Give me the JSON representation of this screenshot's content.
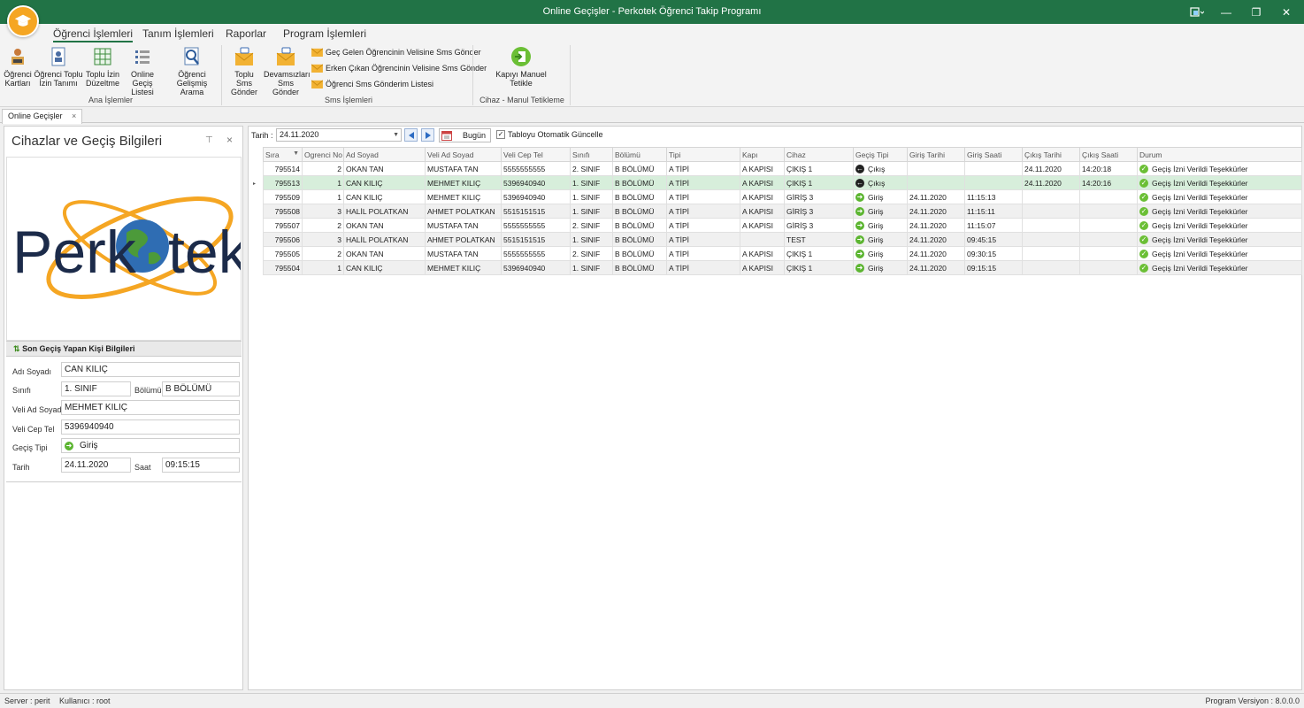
{
  "window": {
    "title": "Online Geçişler - Perkotek Öğrenci Takip Programı",
    "controls": {
      "restore": "❐",
      "minimize": "—",
      "maximize": "☐",
      "close": "✕"
    }
  },
  "menu": {
    "tabs": [
      "Öğrenci İşlemleri",
      "Tanım İşlemleri",
      "Raporlar",
      "Program İşlemleri"
    ]
  },
  "ribbon": {
    "ana": {
      "group_label": "Ana İşlemler",
      "buttons": [
        {
          "line1": "Öğrenci",
          "line2": "Kartları",
          "icon": "person-card-icon"
        },
        {
          "line1": "Öğrenci Toplu",
          "line2": "İzin Tanımı",
          "icon": "document-person-icon"
        },
        {
          "line1": "Toplu İzin",
          "line2": "Düzeltme",
          "icon": "grid-icon"
        },
        {
          "line1": "Online Geçiş",
          "line2": "Listesi",
          "icon": "list-icon"
        },
        {
          "line1": "Öğrenci",
          "line2": "Gelişmiş Arama",
          "icon": "magnifier-icon"
        }
      ]
    },
    "sms": {
      "group_label": "Sms İşlemleri",
      "buttons": [
        {
          "line1": "Toplu Sms",
          "line2": "Gönder",
          "icon": "sms-envelope-icon"
        },
        {
          "line1": "Devamsızları",
          "line2": "Sms Gönder",
          "icon": "sms-envelope-icon"
        }
      ],
      "items": [
        "Geç Gelen Öğrencinin Velisine Sms Gönder",
        "Erken Çıkan Öğrencinin Velisine Sms Gönder",
        "Öğrenci Sms Gönderim Listesi"
      ]
    },
    "cihaz": {
      "group_label": "Cihaz - Manul Tetikleme",
      "button": {
        "line1": "Kapıyı Manuel",
        "line2": "Tetikle",
        "icon": "door-trigger-icon"
      }
    }
  },
  "doc_tab": {
    "label": "Online Geçişler",
    "close": "×"
  },
  "left_panel": {
    "title": "Cihazlar ve Geçiş Bilgileri",
    "pin": "⊤",
    "close": "×",
    "logo_text": "Perkotek",
    "section_title": "Son Geçiş Yapan Kişi Bilgileri",
    "fields": {
      "adi_soyadi": {
        "label": "Adı Soyadı",
        "value": "CAN KILIÇ"
      },
      "sinifi": {
        "label": "Sınıfı",
        "value": "1. SINIF"
      },
      "bolumu": {
        "label": "Bölümü",
        "value": "B BÖLÜMÜ"
      },
      "veli_ad_soyad": {
        "label": "Veli Ad Soyad",
        "value": "MEHMET KILIÇ"
      },
      "veli_cep_tel": {
        "label": "Veli Cep Tel",
        "value": "5396940940"
      },
      "gecis_tipi": {
        "label": "Geçiş Tipi",
        "value": "Giriş"
      },
      "tarih": {
        "label": "Tarih",
        "value": "24.11.2020"
      },
      "saat": {
        "label": "Saat",
        "value": "09:15:15"
      }
    }
  },
  "toolbar": {
    "tarih_label": "Tarih :",
    "tarih_value": "24.11.2020",
    "bugun_label": "Bugün",
    "auto_update_label": "Tabloyu Otomatik Güncelle",
    "auto_update_checked": true
  },
  "grid": {
    "columns": [
      "Sıra",
      "Ogrenci No",
      "Ad Soyad",
      "Veli Ad Soyad",
      "Veli Cep Tel",
      "Sınıfı",
      "Bölümü",
      "Tipi",
      "Kapı",
      "Cihaz",
      "Geçiş Tipi",
      "Giriş Tarihi",
      "Giriş Saati",
      "Çıkış Tarihi",
      "Çıkış Saati",
      "Durum"
    ],
    "selected_row": 1,
    "rows": [
      [
        "795514",
        "2",
        "OKAN TAN",
        "MUSTAFA TAN",
        "5555555555",
        "2. SINIF",
        "B BÖLÜMÜ",
        "A TİPİ",
        "A KAPISI",
        "ÇIKIŞ 1",
        "Çıkış",
        "",
        "",
        "24.11.2020",
        "14:20:18",
        "Geçiş İzni Verildi Teşekkürler"
      ],
      [
        "795513",
        "1",
        "CAN KILIÇ",
        "MEHMET KILIÇ",
        "5396940940",
        "1. SINIF",
        "B BÖLÜMÜ",
        "A TİPİ",
        "A KAPISI",
        "ÇIKIŞ 1",
        "Çıkış",
        "",
        "",
        "24.11.2020",
        "14:20:16",
        "Geçiş İzni Verildi Teşekkürler"
      ],
      [
        "795509",
        "1",
        "CAN KILIÇ",
        "MEHMET KILIÇ",
        "5396940940",
        "1. SINIF",
        "B BÖLÜMÜ",
        "A TİPİ",
        "A KAPISI",
        "GİRİŞ 3",
        "Giriş",
        "24.11.2020",
        "11:15:13",
        "",
        "",
        "Geçiş İzni Verildi Teşekkürler"
      ],
      [
        "795508",
        "3",
        "HALİL POLATKAN",
        "AHMET POLATKAN",
        "5515151515",
        "1. SINIF",
        "B BÖLÜMÜ",
        "A TİPİ",
        "A KAPISI",
        "GİRİŞ 3",
        "Giriş",
        "24.11.2020",
        "11:15:11",
        "",
        "",
        "Geçiş İzni Verildi Teşekkürler"
      ],
      [
        "795507",
        "2",
        "OKAN TAN",
        "MUSTAFA TAN",
        "5555555555",
        "2. SINIF",
        "B BÖLÜMÜ",
        "A TİPİ",
        "A KAPISI",
        "GİRİŞ 3",
        "Giriş",
        "24.11.2020",
        "11:15:07",
        "",
        "",
        "Geçiş İzni Verildi Teşekkürler"
      ],
      [
        "795506",
        "3",
        "HALİL POLATKAN",
        "AHMET POLATKAN",
        "5515151515",
        "1. SINIF",
        "B BÖLÜMÜ",
        "A TİPİ",
        "",
        "TEST",
        "Giriş",
        "24.11.2020",
        "09:45:15",
        "",
        "",
        "Geçiş İzni Verildi Teşekkürler"
      ],
      [
        "795505",
        "2",
        "OKAN TAN",
        "MUSTAFA TAN",
        "5555555555",
        "2. SINIF",
        "B BÖLÜMÜ",
        "A TİPİ",
        "A KAPISI",
        "ÇIKIŞ 1",
        "Giriş",
        "24.11.2020",
        "09:30:15",
        "",
        "",
        "Geçiş İzni Verildi Teşekkürler"
      ],
      [
        "795504",
        "1",
        "CAN KILIÇ",
        "MEHMET KILIÇ",
        "5396940940",
        "1. SINIF",
        "B BÖLÜMÜ",
        "A TİPİ",
        "A KAPISI",
        "ÇIKIŞ 1",
        "Giriş",
        "24.11.2020",
        "09:15:15",
        "",
        "",
        "Geçiş İzni Verildi Teşekkürler"
      ]
    ]
  },
  "status": {
    "server": "Server : perit",
    "user": "Kullanıcı : root",
    "version": "Program Versiyon : 8.0.0.0"
  },
  "colors": {
    "accent": "#217346",
    "selected_row": "#d7eedb",
    "giris_icon": "#5cb531",
    "cikis_icon": "#222222"
  }
}
